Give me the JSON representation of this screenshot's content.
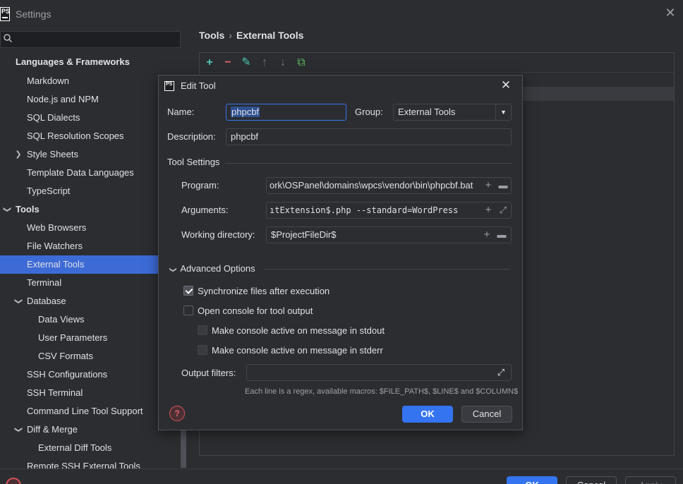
{
  "window": {
    "title": "Settings",
    "logo_text": "PS",
    "close_icon": "✕"
  },
  "search": {
    "placeholder": ""
  },
  "sidebar": {
    "items": [
      {
        "label": "Languages & Frameworks"
      },
      {
        "label": "Markdown"
      },
      {
        "label": "Node.js and NPM"
      },
      {
        "label": "SQL Dialects"
      },
      {
        "label": "SQL Resolution Scopes"
      },
      {
        "label": "Style Sheets"
      },
      {
        "label": "Template Data Languages"
      },
      {
        "label": "TypeScript"
      },
      {
        "label": "Tools"
      },
      {
        "label": "Web Browsers"
      },
      {
        "label": "File Watchers"
      },
      {
        "label": "External Tools"
      },
      {
        "label": "Terminal"
      },
      {
        "label": "Database"
      },
      {
        "label": "Data Views"
      },
      {
        "label": "User Parameters"
      },
      {
        "label": "CSV Formats"
      },
      {
        "label": "SSH Configurations"
      },
      {
        "label": "SSH Terminal"
      },
      {
        "label": "Command Line Tool Support"
      },
      {
        "label": "Diff & Merge"
      },
      {
        "label": "External Diff Tools"
      },
      {
        "label": "Remote SSH External Tools"
      }
    ]
  },
  "breadcrumb": {
    "parent": "Tools",
    "separator": "›",
    "current": "External Tools"
  },
  "toolbar": {
    "add": "+",
    "remove": "−",
    "edit": "✎",
    "up": "↑",
    "down": "↓",
    "copy": "⧉"
  },
  "footer": {
    "ok": "OK",
    "cancel": "Cancel",
    "apply": "Apply",
    "help": "?"
  },
  "dialog": {
    "logo_text": "PS",
    "title": "Edit Tool",
    "close": "✕",
    "name_label": "Name:",
    "name_value": "phpcbf",
    "group_label": "Group:",
    "group_value": "External Tools",
    "description_label": "Description:",
    "description_value": "phpcbf",
    "tool_settings": "Tool Settings",
    "program_label": "Program:",
    "program_value": "ork\\OSPanel\\domains\\wpcs\\vendor\\bin\\phpcbf.bat",
    "arguments_label": "Arguments:",
    "arguments_value": "ıtExtension$.php --standard=WordPress",
    "working_dir_label": "Working directory:",
    "working_dir_value": "$ProjectFileDir$",
    "advanced_options": "Advanced Options",
    "sync_files": "Synchronize files after execution",
    "sync_files_checked": true,
    "open_console": "Open console for tool output",
    "open_console_checked": false,
    "console_stdout": "Make console active on message in stdout",
    "console_stderr": "Make console active on message in stderr",
    "output_filters_label": "Output filters:",
    "output_filters_value": "",
    "hint": "Each line is a regex, available macros: $FILE_PATH$, $LINE$ and $COLUMN$",
    "ok": "OK",
    "cancel": "Cancel",
    "help": "?"
  },
  "colors": {
    "accent": "#3574f0",
    "selection": "#3d6bd6",
    "background": "#2b2d30"
  }
}
